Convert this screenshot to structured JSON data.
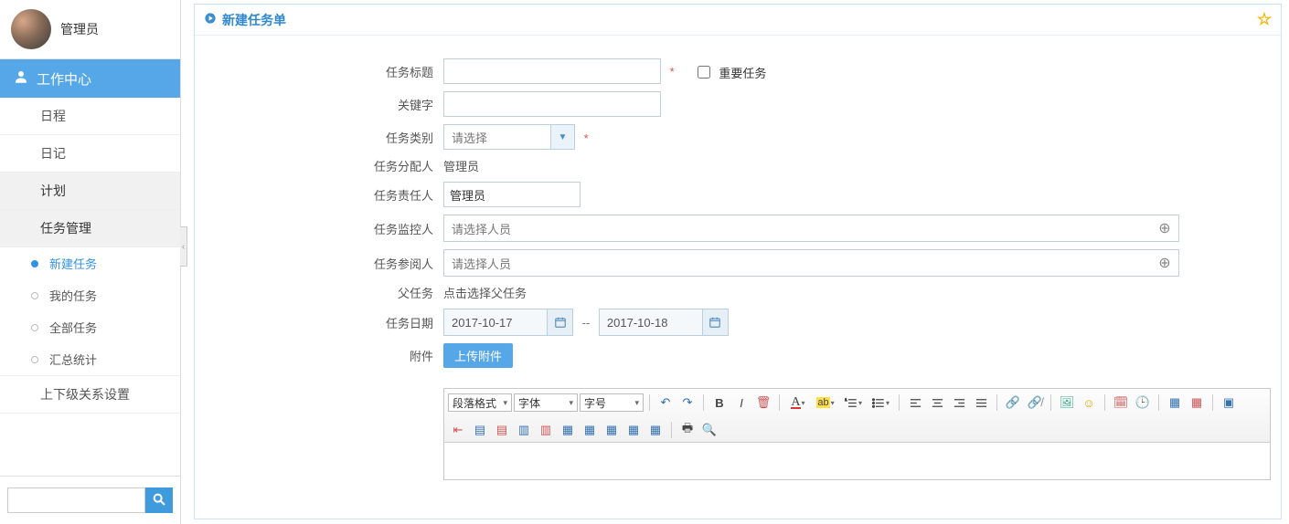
{
  "user": {
    "name": "管理员"
  },
  "sidebar": {
    "sectionTitle": "工作中心",
    "items": [
      {
        "label": "日程"
      },
      {
        "label": "日记"
      },
      {
        "label": "计划"
      },
      {
        "label": "任务管理"
      },
      {
        "label": "上下级关系设置"
      }
    ],
    "taskSubItems": [
      {
        "label": "新建任务"
      },
      {
        "label": "我的任务"
      },
      {
        "label": "全部任务"
      },
      {
        "label": "汇总统计"
      }
    ],
    "searchPlaceholder": ""
  },
  "panel": {
    "title": "新建任务单"
  },
  "form": {
    "labels": {
      "title": "任务标题",
      "keyword": "关键字",
      "category": "任务类别",
      "assigner": "任务分配人",
      "responsible": "任务责任人",
      "supervisor": "任务监控人",
      "reviewer": "任务参阅人",
      "parent": "父任务",
      "dates": "任务日期",
      "attachment": "附件"
    },
    "important": "重要任务",
    "categoryPlaceholder": "请选择",
    "assignerValue": "管理员",
    "responsibleValue": "管理员",
    "pickerPlaceholder": "请选择人员",
    "parentPlaceholder": "点击选择父任务",
    "startDate": "2017-10-17",
    "endDate": "2017-10-18",
    "uploadLabel": "上传附件"
  },
  "editor": {
    "paragraph": "段落格式",
    "font": "字体",
    "size": "字号"
  }
}
